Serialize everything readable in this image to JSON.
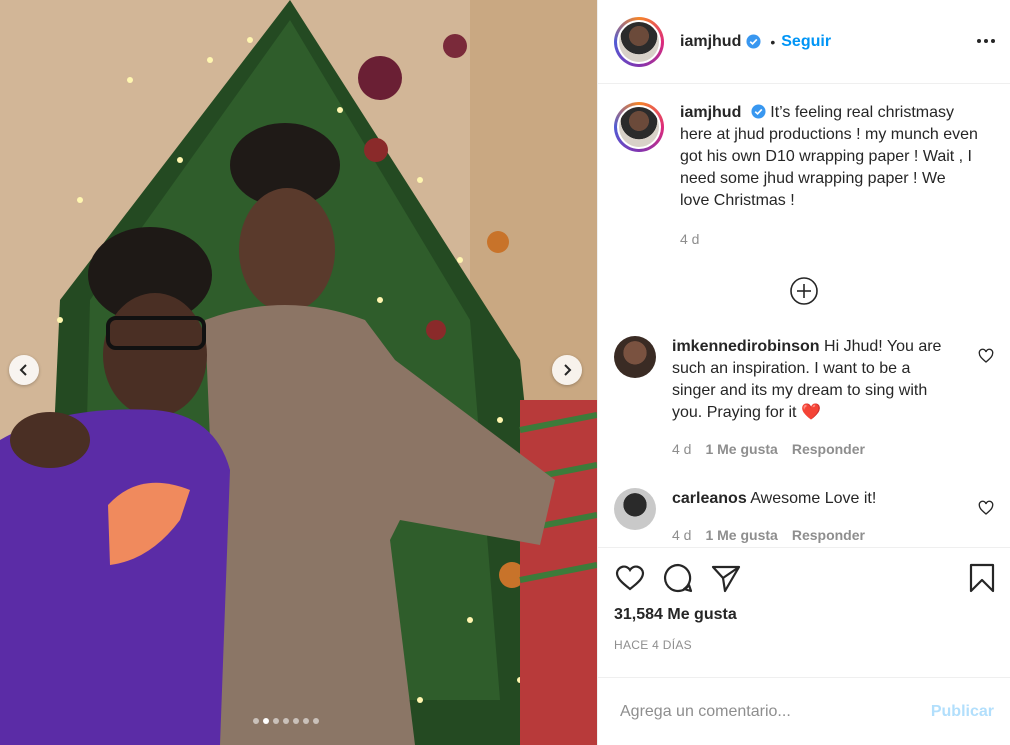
{
  "post": {
    "username": "iamjhud",
    "follow_label": "Seguir",
    "dot_separator": "•",
    "caption": "It’s feeling real christmasy here at jhud productions ! my munch even got his own D10 wrapping paper ! Wait , I need some jhud wrapping paper ! We love Christmas !",
    "caption_time": "4 d",
    "likes": "31,584 Me gusta",
    "posted_ago": "HACE 4 DÍAS",
    "photo_count": 7,
    "photo_active_index": 1
  },
  "comments": [
    {
      "username": "imkennedirobinson",
      "text": "Hi Jhud! You are such an inspiration. I want to be a singer and its my dream to sing with you. Praying for it",
      "emoji": "❤️",
      "time": "4 d",
      "likes": "1 Me gusta",
      "reply": "Responder"
    },
    {
      "username": "carleanos",
      "text": "Awesome Love it!",
      "time": "4 d",
      "likes": "1 Me gusta",
      "reply": "Responder"
    }
  ],
  "composer": {
    "placeholder": "Agrega un comentario...",
    "publish_label": "Publicar"
  },
  "colors": {
    "accent": "#0095f6",
    "publish_disabled": "#b2dffc",
    "heart_emoji": "#e0102e"
  },
  "icons": {
    "verified": "verified-badge-icon",
    "more": "more-options-icon",
    "like": "heart-icon",
    "comment": "comment-icon",
    "share": "paper-plane-icon",
    "save": "bookmark-icon",
    "load_more": "plus-circle-icon"
  }
}
